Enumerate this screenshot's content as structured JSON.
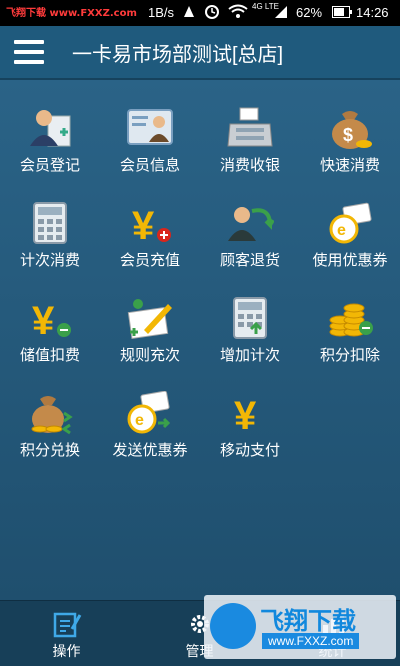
{
  "status_bar": {
    "watermark": "飞翔下载 www.FXXZ.com",
    "speed": "1B/s",
    "network": "4G LTE",
    "battery": "62%",
    "time": "14:26"
  },
  "header": {
    "title": "一卡易市场部测试[总店]"
  },
  "tiles": [
    {
      "label": "会员登记",
      "icon": "member-register-icon"
    },
    {
      "label": "会员信息",
      "icon": "member-info-icon"
    },
    {
      "label": "消费收银",
      "icon": "cashier-icon"
    },
    {
      "label": "快速消费",
      "icon": "money-bag-icon"
    },
    {
      "label": "计次消费",
      "icon": "calculator-icon"
    },
    {
      "label": "会员充值",
      "icon": "yen-add-icon"
    },
    {
      "label": "顾客退货",
      "icon": "customer-return-icon"
    },
    {
      "label": "使用优惠券",
      "icon": "coupon-icon"
    },
    {
      "label": "储值扣费",
      "icon": "yen-minus-icon"
    },
    {
      "label": "规则充次",
      "icon": "rule-edit-icon"
    },
    {
      "label": "增加计次",
      "icon": "calculator-add-icon"
    },
    {
      "label": "积分扣除",
      "icon": "coins-minus-icon"
    },
    {
      "label": "积分兑换",
      "icon": "money-bag-exchange-icon"
    },
    {
      "label": "发送优惠券",
      "icon": "coupon-send-icon"
    },
    {
      "label": "移动支付",
      "icon": "yen-icon"
    }
  ],
  "bottom_nav": [
    {
      "label": "操作",
      "icon": "edit-icon"
    },
    {
      "label": "管理",
      "icon": "gear-icon"
    },
    {
      "label": "统计",
      "icon": "chart-icon"
    }
  ],
  "watermark_overlay": {
    "brand": "飞翔下载",
    "url": "www.FXXZ.com"
  },
  "colors": {
    "header": "#1f5a7d",
    "main_background": "#2a6387",
    "bottom_nav": "#173f58",
    "yen_gold": "#f2b705"
  }
}
